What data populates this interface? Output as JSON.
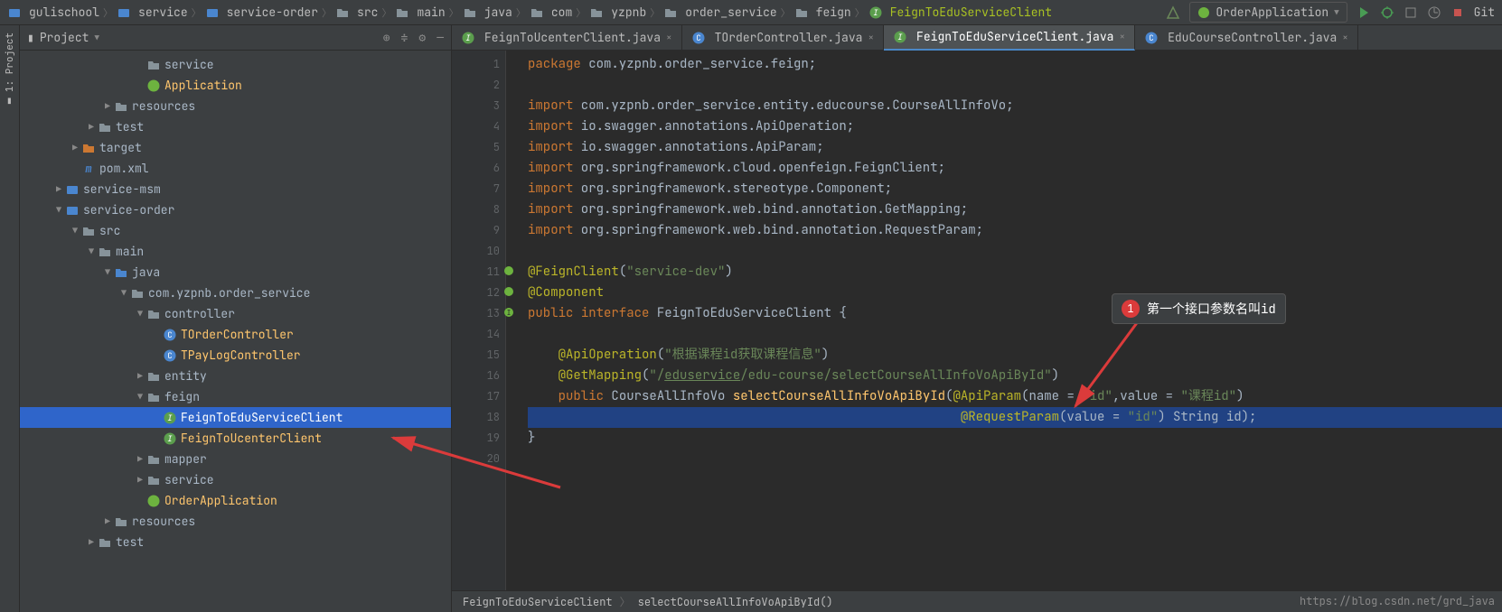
{
  "breadcrumbs": [
    {
      "icon": "module",
      "label": "gulischool"
    },
    {
      "icon": "module",
      "label": "service"
    },
    {
      "icon": "module",
      "label": "service-order"
    },
    {
      "icon": "folder",
      "label": "src"
    },
    {
      "icon": "folder",
      "label": "main"
    },
    {
      "icon": "folder",
      "label": "java"
    },
    {
      "icon": "folder",
      "label": "com"
    },
    {
      "icon": "folder",
      "label": "yzpnb"
    },
    {
      "icon": "folder",
      "label": "order_service"
    },
    {
      "icon": "folder",
      "label": "feign"
    },
    {
      "icon": "interface",
      "label": "FeignToEduServiceClient",
      "last": true
    }
  ],
  "run_config": "OrderApplication",
  "top_right_git": "Git",
  "side_tool": "1: Project",
  "project_panel_title": "Project",
  "tree": [
    {
      "indent": 7,
      "arrow": "",
      "icon": "folder",
      "label": "service"
    },
    {
      "indent": 7,
      "arrow": "",
      "icon": "spring",
      "label": "Application"
    },
    {
      "indent": 5,
      "arrow": "▶",
      "icon": "folder",
      "label": "resources"
    },
    {
      "indent": 4,
      "arrow": "▶",
      "icon": "folder",
      "label": "test"
    },
    {
      "indent": 3,
      "arrow": "▶",
      "icon": "target",
      "label": "target"
    },
    {
      "indent": 3,
      "arrow": "",
      "icon": "xml",
      "label": "pom.xml",
      "xmlprefix": "m"
    },
    {
      "indent": 2,
      "arrow": "▶",
      "icon": "module",
      "label": "service-msm"
    },
    {
      "indent": 2,
      "arrow": "▼",
      "icon": "module",
      "label": "service-order"
    },
    {
      "indent": 3,
      "arrow": "▼",
      "icon": "folder",
      "label": "src"
    },
    {
      "indent": 4,
      "arrow": "▼",
      "icon": "folder",
      "label": "main"
    },
    {
      "indent": 5,
      "arrow": "▼",
      "icon": "folder-b",
      "label": "java"
    },
    {
      "indent": 6,
      "arrow": "▼",
      "icon": "folder",
      "label": "com.yzpnb.order_service"
    },
    {
      "indent": 7,
      "arrow": "▼",
      "icon": "folder",
      "label": "controller"
    },
    {
      "indent": 8,
      "arrow": "",
      "icon": "class",
      "label": "TOrderController"
    },
    {
      "indent": 8,
      "arrow": "",
      "icon": "class",
      "label": "TPayLogController"
    },
    {
      "indent": 7,
      "arrow": "▶",
      "icon": "folder",
      "label": "entity"
    },
    {
      "indent": 7,
      "arrow": "▼",
      "icon": "folder",
      "label": "feign"
    },
    {
      "indent": 8,
      "arrow": "",
      "icon": "interface",
      "label": "FeignToEduServiceClient",
      "selected": true
    },
    {
      "indent": 8,
      "arrow": "",
      "icon": "interface",
      "label": "FeignToUcenterClient"
    },
    {
      "indent": 7,
      "arrow": "▶",
      "icon": "folder",
      "label": "mapper"
    },
    {
      "indent": 7,
      "arrow": "▶",
      "icon": "folder",
      "label": "service"
    },
    {
      "indent": 7,
      "arrow": "",
      "icon": "spring",
      "label": "OrderApplication"
    },
    {
      "indent": 5,
      "arrow": "▶",
      "icon": "folder",
      "label": "resources"
    },
    {
      "indent": 4,
      "arrow": "▶",
      "icon": "folder",
      "label": "test"
    }
  ],
  "tabs": [
    {
      "icon": "interface",
      "label": "FeignToUcenterClient.java",
      "active": false
    },
    {
      "icon": "class",
      "label": "TOrderController.java",
      "active": false
    },
    {
      "icon": "interface",
      "label": "FeignToEduServiceClient.java",
      "active": true
    },
    {
      "icon": "class",
      "label": "EduCourseController.java",
      "active": false
    }
  ],
  "code_lines": [
    {
      "n": 1,
      "html": "<span class='kw'>package</span> com.yzpnb.order_service.feign;"
    },
    {
      "n": 2,
      "html": ""
    },
    {
      "n": 3,
      "html": "<span class='kw'>import</span> com.yzpnb.order_service.entity.educourse.CourseAllInfoVo;"
    },
    {
      "n": 4,
      "html": "<span class='kw'>import</span> io.swagger.annotations.ApiOperation;"
    },
    {
      "n": 5,
      "html": "<span class='kw'>import</span> io.swagger.annotations.ApiParam;"
    },
    {
      "n": 6,
      "html": "<span class='kw'>import</span> org.springframework.cloud.openfeign.FeignClient;"
    },
    {
      "n": 7,
      "html": "<span class='kw'>import</span> org.springframework.stereotype.Component;"
    },
    {
      "n": 8,
      "html": "<span class='kw'>import</span> org.springframework.web.bind.annotation.GetMapping;"
    },
    {
      "n": 9,
      "html": "<span class='kw'>import</span> org.springframework.web.bind.annotation.RequestParam;"
    },
    {
      "n": 10,
      "html": ""
    },
    {
      "n": 11,
      "html": "<span class='ann'>@FeignClient</span>(<span class='str'>\"service-dev\"</span>)",
      "gutter": "spring"
    },
    {
      "n": 12,
      "html": "<span class='ann'>@Component</span>",
      "gutter": "spring"
    },
    {
      "n": 13,
      "html": "<span class='kw'>public</span> <span class='kw'>interface</span> FeignToEduServiceClient {",
      "gutter": "impl"
    },
    {
      "n": 14,
      "html": ""
    },
    {
      "n": 15,
      "html": "    <span class='ann'>@ApiOperation</span>(<span class='str'>\"根据课程id获取课程信息\"</span>)"
    },
    {
      "n": 16,
      "html": "    <span class='ann'>@GetMapping</span>(<span class='str'>\"/<u>eduservice</u>/edu-course/selectCourseAllInfoVoApiById\"</span>)"
    },
    {
      "n": 17,
      "html": "    <span class='kw'>public</span> CourseAllInfoVo <span class='fn'>selectCourseAllInfoVoApiById</span>(<span class='ann'>@ApiParam</span>(name = <span class='str'>\"id\"</span>,value = <span class='str'>\"课程id\"</span>)"
    },
    {
      "n": 18,
      "html": "                                                         <span class='ann'>@RequestParam</span>(value = <span class='str'>\"id\"</span>) String id);",
      "highlight": true
    },
    {
      "n": 19,
      "html": "}"
    },
    {
      "n": 20,
      "html": ""
    }
  ],
  "bottom_crumbs": [
    "FeignToEduServiceClient",
    "selectCourseAllInfoVoApiById()"
  ],
  "annotation": {
    "num": "1",
    "text": "第一个接口参数名叫id"
  },
  "watermark": "https://blog.csdn.net/grd_java"
}
